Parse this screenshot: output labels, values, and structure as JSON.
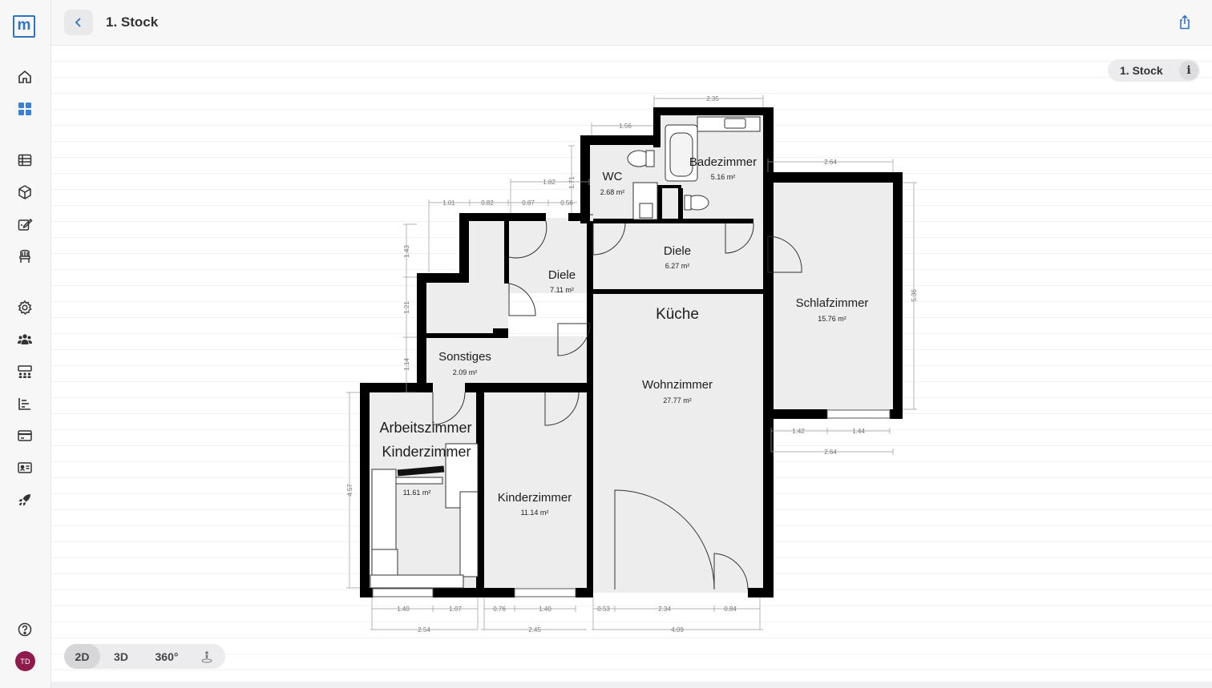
{
  "header": {
    "title": "1. Stock"
  },
  "floor_selector": {
    "label": "1. Stock",
    "info": "i"
  },
  "user": {
    "initials": "TD"
  },
  "view_modes": [
    "2D",
    "3D",
    "360°"
  ],
  "active_view": "2D",
  "colors": {
    "accent": "#2f73c9",
    "avatar": "#8e1b4b",
    "wall": "#000000",
    "floor": "#ededee"
  },
  "rooms": {
    "wc": {
      "name": "WC",
      "area": "2.68 m²"
    },
    "bad": {
      "name": "Badezimmer",
      "area": "5.16 m²"
    },
    "diele1": {
      "name": "Diele",
      "area": "6.27 m²"
    },
    "diele2": {
      "name": "Diele",
      "area": "7.11 m²"
    },
    "kueche": {
      "name": "Küche"
    },
    "schlaf": {
      "name": "Schlafzimmer",
      "area": "15.76 m²"
    },
    "sonst": {
      "name": "Sonstiges",
      "area": "2.09 m²"
    },
    "wohn": {
      "name": "Wohnzimmer",
      "area": "27.77 m²"
    },
    "arbeit": {
      "name": "Arbeitszimmer"
    },
    "kind1": {
      "name": "Kinderzimmer",
      "area": "11.61 m²"
    },
    "kind2": {
      "name": "Kinderzimmer",
      "area": "11.14 m²"
    }
  },
  "dimensions": {
    "d235": "2.35",
    "d156": "1.56",
    "d264": "2.64",
    "d182": "1.82",
    "d101": "1.01",
    "d082": "0.82",
    "d087": "0.87",
    "d056": "0.56",
    "d171": "1.71",
    "d143": "1.43",
    "d121": "1.21",
    "d114": "1.14",
    "d457": "4.57",
    "d536": "5.36",
    "d142": "1.42",
    "d144": "1.44",
    "d264b": "2.64",
    "d140a": "1.40",
    "d107": "1.07",
    "d076": "0.76",
    "d140b": "1.40",
    "d053": "0.53",
    "d234": "2.34",
    "d084": "0.84",
    "d254": "2.54",
    "d245": "2.45",
    "d409": "4.09"
  }
}
